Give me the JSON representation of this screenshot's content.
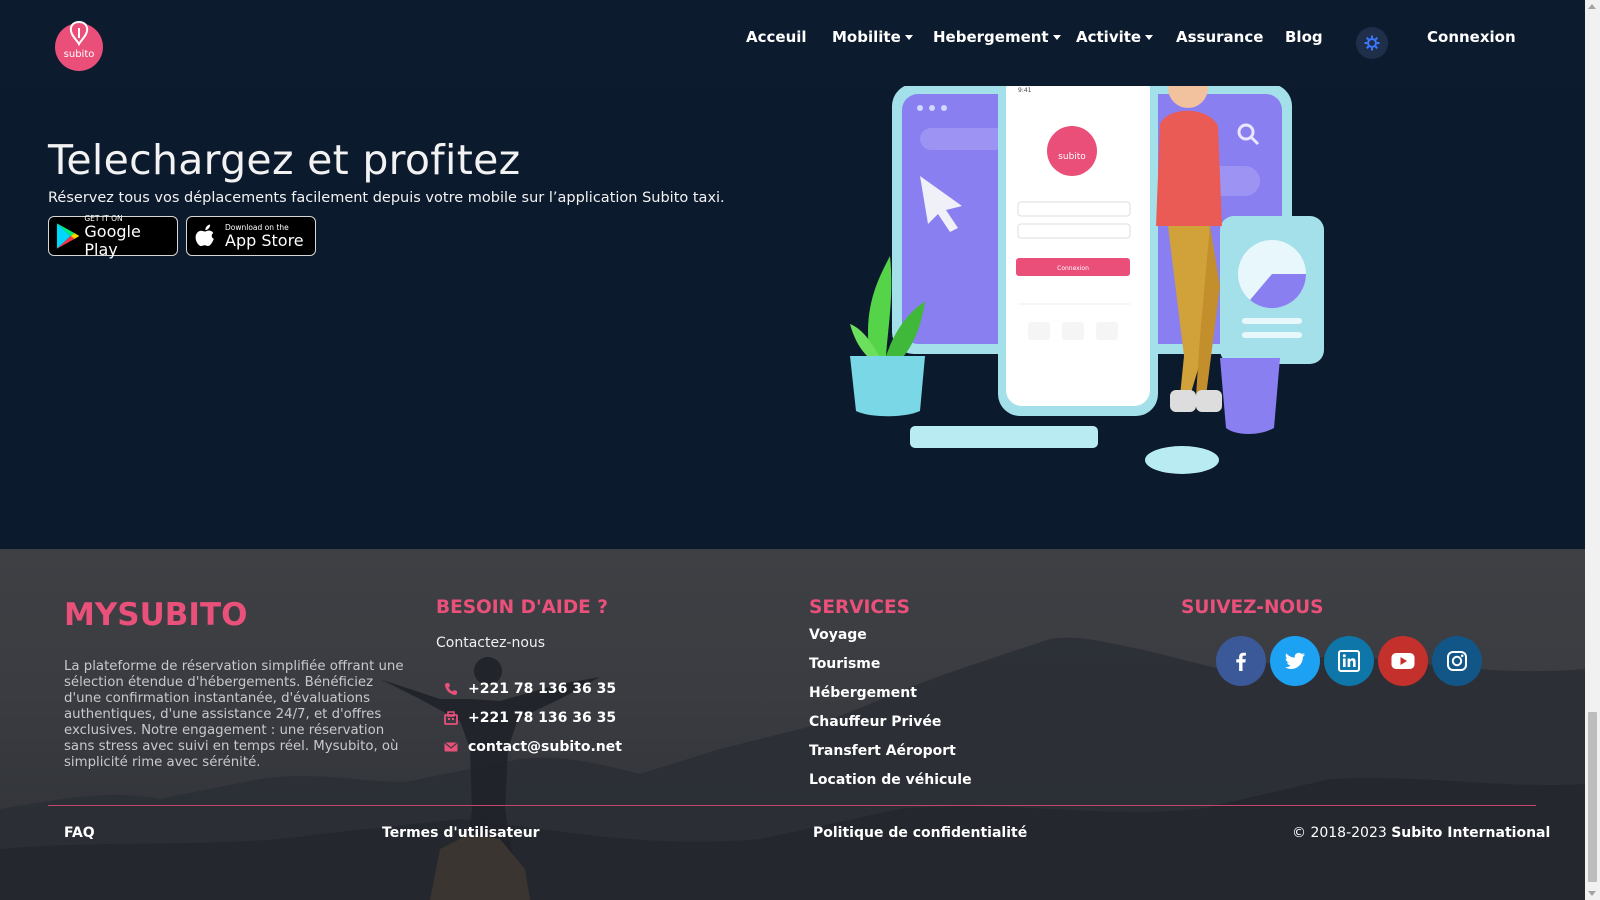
{
  "nav": {
    "logo_text": "subito",
    "items": [
      {
        "label": "Acceuil",
        "dropdown": false
      },
      {
        "label": "Mobilite",
        "dropdown": true
      },
      {
        "label": "Hebergement",
        "dropdown": true
      },
      {
        "label": "Activite",
        "dropdown": true
      },
      {
        "label": "Assurance",
        "dropdown": false
      },
      {
        "label": "Blog",
        "dropdown": false
      }
    ],
    "theme_icon": "gear-icon",
    "login_label": "Connexion"
  },
  "hero": {
    "title": "Telechargez et profitez",
    "subtitle": "Réservez tous vos déplacements facilement depuis votre mobile sur l’application Subito taxi.",
    "google_play": {
      "small": "GET IT ON",
      "big": "Google Play"
    },
    "app_store": {
      "small": "Download on the",
      "big": "App Store"
    },
    "phone_logo_text": "subito",
    "phone_button": "Connexion"
  },
  "footer": {
    "brand": {
      "title": "MYSUBITO",
      "description": "La plateforme de réservation simplifiée offrant une sélection étendue d'hébergements. Bénéficiez d'une confirmation instantanée, d'évaluations authentiques, d'une assistance 24/7, et d'offres exclusives. Notre engagement : une réservation sans stress avec suivi en temps réel. Mysubito, où simplicité rime avec sérénité."
    },
    "help": {
      "title": "BESOIN D'AIDE ?",
      "contact_label": "Contactez-nous",
      "phone": "+221 78 136 36 35",
      "fax": "+221 78 136 36 35",
      "email": "contact@subito.net"
    },
    "services": {
      "title": "SERVICES",
      "items": [
        "Voyage",
        "Tourisme",
        "Hébergement",
        "Chauffeur Privée",
        "Transfert Aéroport",
        "Location de véhicule"
      ]
    },
    "follow": {
      "title": "SUIVEZ-NOUS",
      "networks": [
        {
          "name": "facebook",
          "color": "#3b5998"
        },
        {
          "name": "twitter",
          "color": "#1da1f2"
        },
        {
          "name": "linkedin",
          "color": "#0e76a8"
        },
        {
          "name": "youtube",
          "color": "#c4302b"
        },
        {
          "name": "instagram",
          "color": "#125688"
        }
      ]
    },
    "bottom": {
      "faq": "FAQ",
      "terms": "Termes d'utilisateur",
      "privacy": "Politique de confidentialité",
      "copyright_prefix": "© 2018-2023",
      "copyright_company": "Subito International"
    }
  },
  "colors": {
    "accent": "#e9507a",
    "nav_bg": "#0d1b2e",
    "hero_bg": "#0c1a2e"
  }
}
